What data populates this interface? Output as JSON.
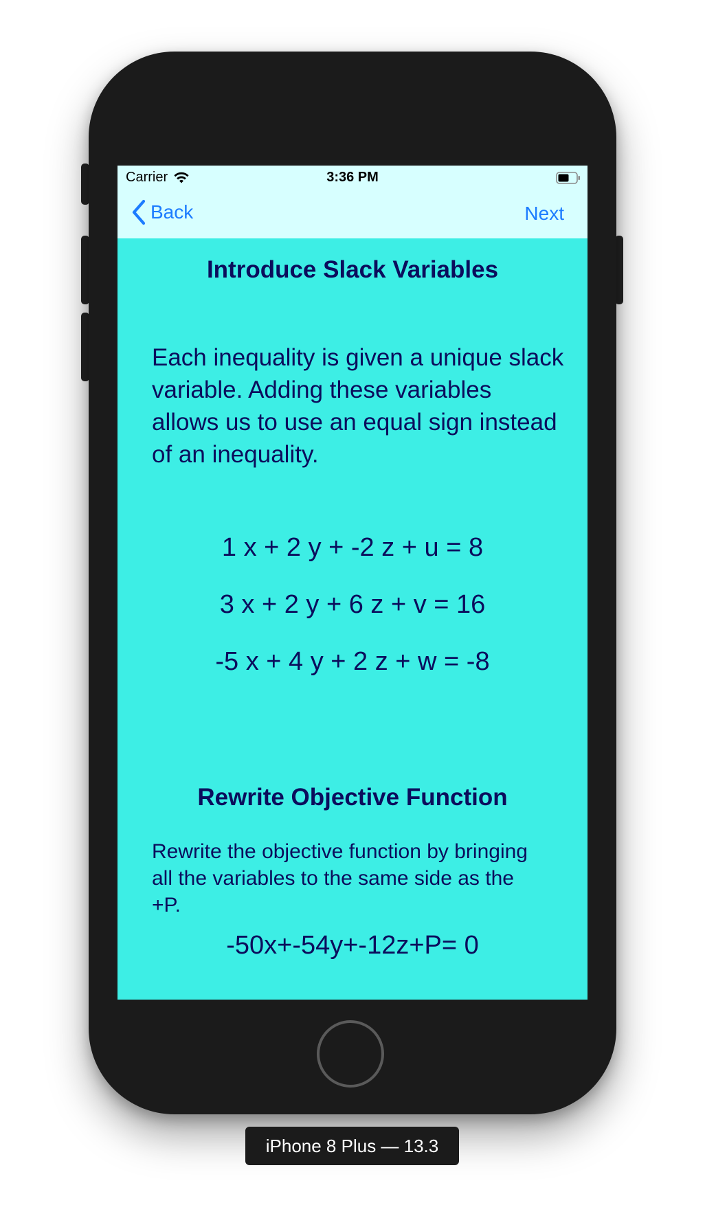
{
  "simulator": {
    "device_label": "iPhone 8 Plus — 13.3"
  },
  "status_bar": {
    "carrier": "Carrier",
    "time": "3:36 PM",
    "wifi_icon": "wifi-icon",
    "battery_icon": "battery-icon"
  },
  "nav": {
    "back_label": "Back",
    "next_label": "Next",
    "back_icon": "chevron-left-icon",
    "tint_color": "#1c7cff",
    "bar_color": "#d7ffff"
  },
  "content": {
    "background_color": "#3deee5",
    "text_color": "#0b0d5c",
    "section1": {
      "title": "Introduce Slack Variables",
      "paragraph": "Each inequality is given a unique slack variable.  Adding these variables allows us to use an equal sign instead of an inequality.",
      "equations": [
        "1 x + 2 y + -2 z + u = 8",
        "3 x + 2 y + 6 z + v = 16",
        "-5 x + 4 y + 2 z + w = -8"
      ]
    },
    "section2": {
      "title": "Rewrite Objective Function",
      "paragraph": "Rewrite the objective function by bringing all the variables to the same side as the +P.",
      "equation": "-50x+-54y+-12z+P= 0"
    }
  }
}
